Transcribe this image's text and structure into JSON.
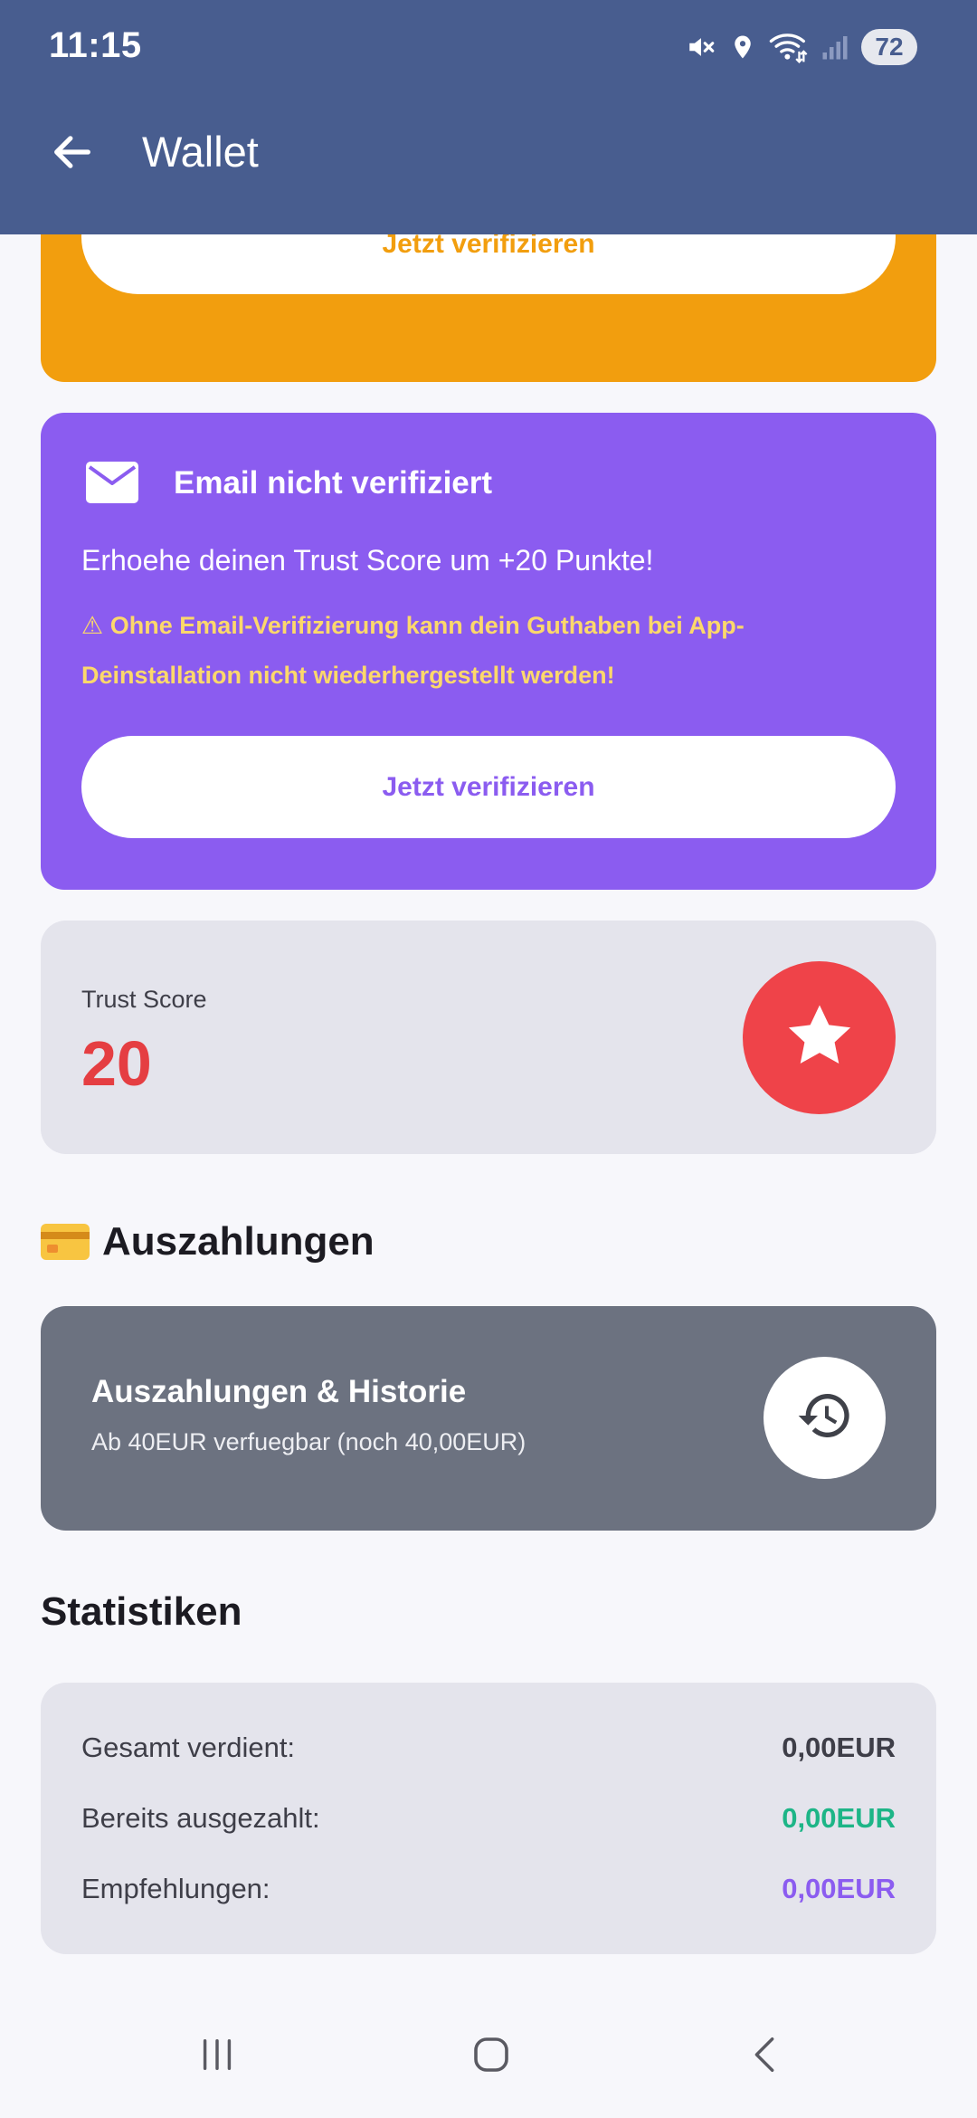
{
  "status_bar": {
    "time": "11:15",
    "battery": "72",
    "icons": [
      "mute-icon",
      "location-icon",
      "wifi-icon",
      "signal-icon"
    ]
  },
  "app_bar": {
    "title": "Wallet",
    "back_icon": "arrow-left-icon"
  },
  "phone_card": {
    "button_label": "Jetzt verifizieren",
    "color": "#F29E0E"
  },
  "email_card": {
    "icon": "mail-icon",
    "title": "Email nicht verifiziert",
    "subtitle": "Erhoehe deinen Trust Score um +20 Punkte!",
    "warning": "⚠ Ohne Email-Verifizierung kann dein Guthaben bei App-Deinstallation nicht wiederhergestellt werden!",
    "button_label": "Jetzt verifizieren",
    "color": "#8B5CF0"
  },
  "trust": {
    "label": "Trust Score",
    "value": "20",
    "icon": "star-icon"
  },
  "payouts": {
    "section_title": "Auszahlungen",
    "section_icon": "credit-card-icon",
    "card_title": "Auszahlungen & Historie",
    "card_subtitle": "Ab 40EUR verfuegbar (noch 40,00EUR)",
    "icon": "history-icon"
  },
  "stats": {
    "title": "Statistiken",
    "rows": [
      {
        "label": "Gesamt verdient:",
        "value": "0,00EUR",
        "color": "#3E3E48"
      },
      {
        "label": "Bereits ausgezahlt:",
        "value": "0,00EUR",
        "color": "#1DB587"
      },
      {
        "label": "Empfehlungen:",
        "value": "0,00EUR",
        "color": "#8B5CF0"
      }
    ]
  },
  "nav_bar": {
    "icons": [
      "recents-icon",
      "home-icon",
      "back-icon"
    ]
  }
}
